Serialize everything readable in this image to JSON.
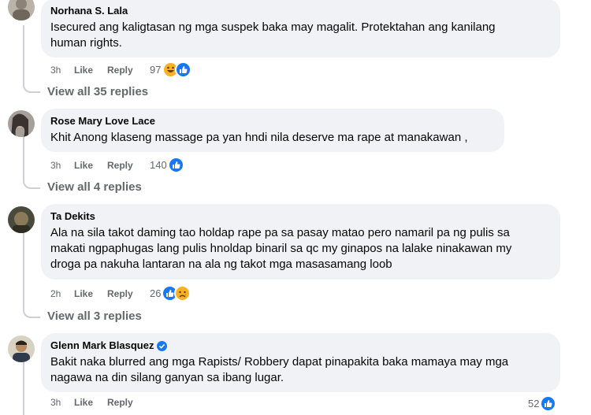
{
  "comments": [
    {
      "author": "Norhana S. Lala",
      "text_line1": "Isecured ang kaligtasan ng mga suspek baka may magalit. Protektahan ang kanilang",
      "text_line2": "human rights.",
      "time": "3h",
      "like_label": "Like",
      "reply_label": "Reply",
      "reaction_count": "97",
      "reactions": [
        "haha-icon",
        "like-icon"
      ],
      "view_replies": "View all 35 replies"
    },
    {
      "author": "Rose Mary Love Lace",
      "text_line1": "Khit Anong klaseng massage pa yan hndi nila deserve ma rape at manakawan ,",
      "time": "3h",
      "like_label": "Like",
      "reply_label": "Reply",
      "reaction_count": "140",
      "reactions": [
        "like-icon"
      ],
      "view_replies": "View all 4 replies"
    },
    {
      "author": "Ta Dekits",
      "text_line1": "Ala na sila takot daming tao holdap rape pa sa pasay matao pero namaril pa ng pulis sa",
      "text_line2": "makati ngpaphugas lang pulis hnoldap binaril sa qc my ginapos na lalake ninakawan my",
      "text_line3": "droga pa nakuha lantaran na ala ng takot mga masasamang loob",
      "time": "2h",
      "like_label": "Like",
      "reply_label": "Reply",
      "reaction_count": "26",
      "reactions": [
        "like-icon",
        "sad-icon"
      ],
      "view_replies": "View all 3 replies"
    },
    {
      "author": "Glenn Mark Blasquez",
      "verified": true,
      "text_line1": "Bakit naka blurred ang mga Rapists/ Robbery dapat pinapakita baka mamaya may mga",
      "text_line2": "nagawa na din silang ganyan sa ibang lugar.",
      "time": "3h",
      "like_label": "Like",
      "reply_label": "Reply",
      "reaction_count": "52",
      "reactions": [
        "like-icon"
      ]
    }
  ],
  "colors": {
    "bubble": "#f0f2f5",
    "secondary_text": "#65676b",
    "like_blue": "#1877f2",
    "haha_yellow": "#f7b125",
    "thread_line": "#ced0d4"
  }
}
